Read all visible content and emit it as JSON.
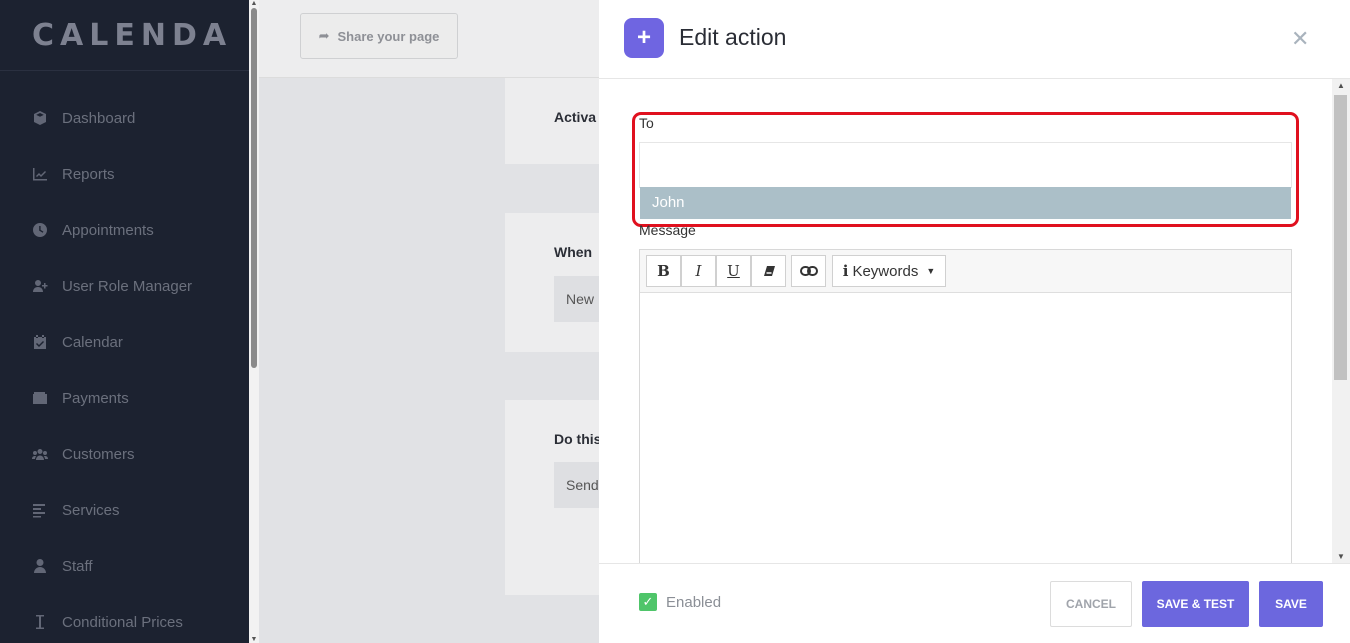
{
  "app": {
    "logo": "CALENDA"
  },
  "sidebar": {
    "items": [
      {
        "label": "Dashboard",
        "icon": "cube-icon"
      },
      {
        "label": "Reports",
        "icon": "chart-icon"
      },
      {
        "label": "Appointments",
        "icon": "clock-icon"
      },
      {
        "label": "User Role Manager",
        "icon": "user-plus-icon"
      },
      {
        "label": "Calendar",
        "icon": "calendar-icon"
      },
      {
        "label": "Payments",
        "icon": "wallet-icon"
      },
      {
        "label": "Customers",
        "icon": "users-icon"
      },
      {
        "label": "Services",
        "icon": "list-icon"
      },
      {
        "label": "Staff",
        "icon": "user-icon"
      },
      {
        "label": "Conditional Prices",
        "icon": "cursor-icon"
      }
    ]
  },
  "background": {
    "share_label": "Share your page",
    "card1_label": "Activa",
    "card2_label": "When",
    "card2_value": "New",
    "card3_label": "Do this",
    "card3_value": "Send"
  },
  "panel": {
    "title": "Edit action",
    "to_label": "To",
    "to_value": "",
    "dropdown_option": "John",
    "message_label": "Message",
    "toolbar": {
      "bold": "B",
      "italic": "I",
      "underline": "U",
      "keywords": "Keywords"
    },
    "enabled_label": "Enabled",
    "enabled": true,
    "cancel_label": "CANCEL",
    "save_test_label": "SAVE & TEST",
    "save_label": "SAVE"
  },
  "colors": {
    "accent": "#6c67de",
    "sidebar_bg": "#1c2230",
    "highlight": "#e0101e",
    "dropdown_hover": "#abbfc8",
    "check": "#4fc56a"
  }
}
